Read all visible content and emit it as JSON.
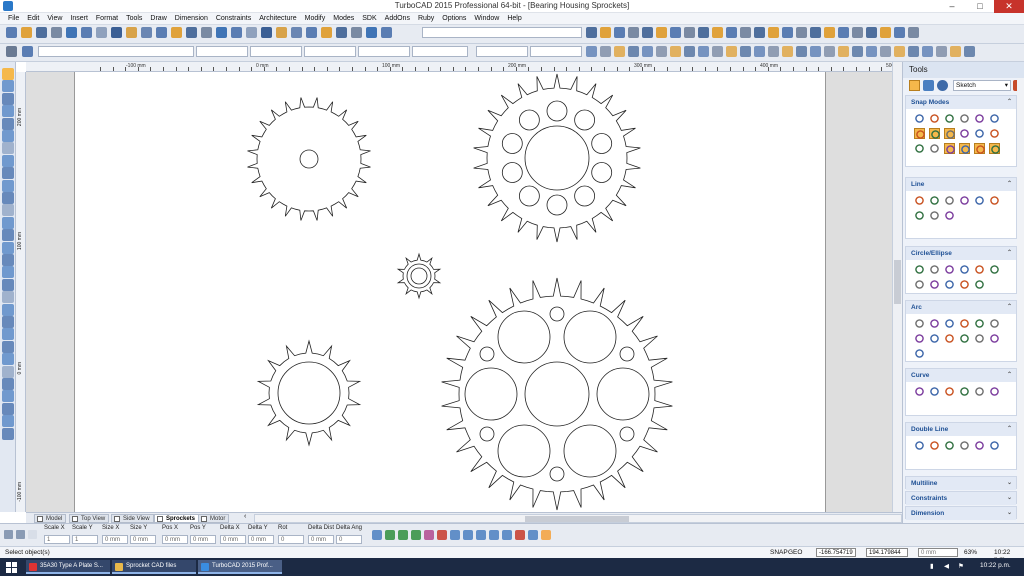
{
  "window": {
    "title": "TurboCAD 2015 Professional 64-bit - [Bearing Housing Sprockets]",
    "minimize": "–",
    "maximize": "□",
    "close": "✕"
  },
  "menu": [
    "File",
    "Edit",
    "View",
    "Insert",
    "Format",
    "Tools",
    "Draw",
    "Dimension",
    "Constraints",
    "Architecture",
    "Modify",
    "Modes",
    "SDK",
    "AddOns",
    "Ruby",
    "Options",
    "Window",
    "Help"
  ],
  "ruler": {
    "labels": [
      "-100 mm",
      "0 mm",
      "100 mm",
      "200 mm",
      "300 mm",
      "400 mm",
      "500"
    ],
    "vlabels": [
      "200 mm",
      "100 mm",
      "0 mm",
      "-100 mm"
    ]
  },
  "view_tabs": [
    "Model",
    "Top View",
    "Side View",
    "Sprockets",
    "Motor"
  ],
  "active_view_tab": "Sprockets",
  "inspector": [
    {
      "label": "Scale X",
      "value": "1"
    },
    {
      "label": "Scale Y",
      "value": "1"
    },
    {
      "label": "Size X",
      "value": "0 mm"
    },
    {
      "label": "Size Y",
      "value": "0 mm"
    },
    {
      "label": "Pos X",
      "value": "0 mm"
    },
    {
      "label": "Pos Y",
      "value": "0 mm"
    },
    {
      "label": "Delta X",
      "value": "0 mm"
    },
    {
      "label": "Delta Y",
      "value": "0 mm"
    },
    {
      "label": "Rot",
      "value": "0"
    },
    {
      "label": "Delta Dist",
      "value": "0 mm"
    },
    {
      "label": "Delta Ang",
      "value": "0"
    }
  ],
  "status": {
    "prompt": "Select object(s)",
    "snap": "SNAP",
    "geo": "GEO",
    "x_coord": "-166.754719 m",
    "y_coord": "194.179844 m",
    "angle": "0 mm",
    "zoom": "63%",
    "time": "10:22 p.m."
  },
  "tools_panel": {
    "title": "Tools",
    "mode": "Sketch",
    "sections": [
      {
        "name": "Snap Modes",
        "icons": 18
      },
      {
        "name": "Line",
        "icons": 9
      },
      {
        "name": "Circle/Ellipse",
        "icons": 11
      },
      {
        "name": "Arc",
        "icons": 13
      },
      {
        "name": "Curve",
        "icons": 6
      },
      {
        "name": "Double Line",
        "icons": 6
      },
      {
        "name": "Multiline",
        "icons": 0
      },
      {
        "name": "Constraints",
        "icons": 0
      },
      {
        "name": "Dimension",
        "icons": 0
      }
    ]
  },
  "taskbar": {
    "items": [
      "35A30 Type A Plate S...",
      "Sprocket CAD files",
      "TurboCAD 2015 Prof..."
    ],
    "time": "10:22 p.m."
  },
  "sprockets": [
    {
      "teeth": 24,
      "bore": "small",
      "holes": 0
    },
    {
      "teeth": 26,
      "bore": "large",
      "holes": 10
    },
    {
      "teeth": 10,
      "bore": "small-ring",
      "holes": 0
    },
    {
      "teeth": 14,
      "bore": "large",
      "holes": 0
    },
    {
      "teeth": 30,
      "bore": "large",
      "holes": 14
    }
  ]
}
